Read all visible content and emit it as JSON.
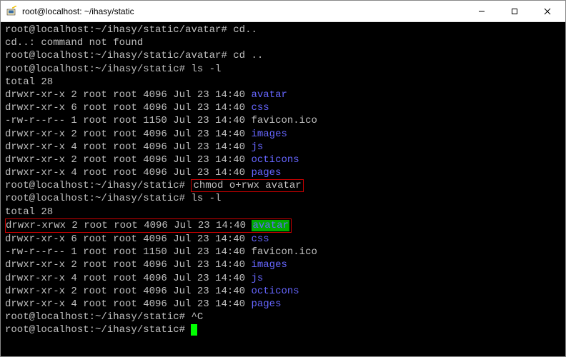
{
  "window": {
    "title": "root@localhost: ~/ihasy/static",
    "icon_name": "putty-icon"
  },
  "prompts": {
    "avatar": "root@localhost:~/ihasy/static/avatar#",
    "static": "root@localhost:~/ihasy/static#"
  },
  "commands": {
    "cd_nospace": "cd..",
    "cd_up": "cd ..",
    "ls_l": "ls -l",
    "chmod": "chmod o+rwx avatar",
    "ctrlc": "^C"
  },
  "errors": {
    "cd_notfound": "cd..: command not found"
  },
  "total_label": "total 28",
  "listing1": [
    {
      "perm": "drwxr-xr-x",
      "links": "2",
      "owner": "root",
      "group": "root",
      "size": "4096",
      "date": "Jul 23 14:40",
      "name": "avatar",
      "dir": true
    },
    {
      "perm": "drwxr-xr-x",
      "links": "6",
      "owner": "root",
      "group": "root",
      "size": "4096",
      "date": "Jul 23 14:40",
      "name": "css",
      "dir": true
    },
    {
      "perm": "-rw-r--r--",
      "links": "1",
      "owner": "root",
      "group": "root",
      "size": "1150",
      "date": "Jul 23 14:40",
      "name": "favicon.ico",
      "dir": false
    },
    {
      "perm": "drwxr-xr-x",
      "links": "2",
      "owner": "root",
      "group": "root",
      "size": "4096",
      "date": "Jul 23 14:40",
      "name": "images",
      "dir": true
    },
    {
      "perm": "drwxr-xr-x",
      "links": "4",
      "owner": "root",
      "group": "root",
      "size": "4096",
      "date": "Jul 23 14:40",
      "name": "js",
      "dir": true
    },
    {
      "perm": "drwxr-xr-x",
      "links": "2",
      "owner": "root",
      "group": "root",
      "size": "4096",
      "date": "Jul 23 14:40",
      "name": "octicons",
      "dir": true
    },
    {
      "perm": "drwxr-xr-x",
      "links": "4",
      "owner": "root",
      "group": "root",
      "size": "4096",
      "date": "Jul 23 14:40",
      "name": "pages",
      "dir": true
    }
  ],
  "listing2": [
    {
      "perm": "drwxr-xrwx",
      "links": "2",
      "owner": "root",
      "group": "root",
      "size": "4096",
      "date": "Jul 23 14:40",
      "name": "avatar",
      "dir": true,
      "highlight": true
    },
    {
      "perm": "drwxr-xr-x",
      "links": "6",
      "owner": "root",
      "group": "root",
      "size": "4096",
      "date": "Jul 23 14:40",
      "name": "css",
      "dir": true
    },
    {
      "perm": "-rw-r--r--",
      "links": "1",
      "owner": "root",
      "group": "root",
      "size": "1150",
      "date": "Jul 23 14:40",
      "name": "favicon.ico",
      "dir": false
    },
    {
      "perm": "drwxr-xr-x",
      "links": "2",
      "owner": "root",
      "group": "root",
      "size": "4096",
      "date": "Jul 23 14:40",
      "name": "images",
      "dir": true
    },
    {
      "perm": "drwxr-xr-x",
      "links": "4",
      "owner": "root",
      "group": "root",
      "size": "4096",
      "date": "Jul 23 14:40",
      "name": "js",
      "dir": true
    },
    {
      "perm": "drwxr-xr-x",
      "links": "2",
      "owner": "root",
      "group": "root",
      "size": "4096",
      "date": "Jul 23 14:40",
      "name": "octicons",
      "dir": true
    },
    {
      "perm": "drwxr-xr-x",
      "links": "4",
      "owner": "root",
      "group": "root",
      "size": "4096",
      "date": "Jul 23 14:40",
      "name": "pages",
      "dir": true
    }
  ]
}
